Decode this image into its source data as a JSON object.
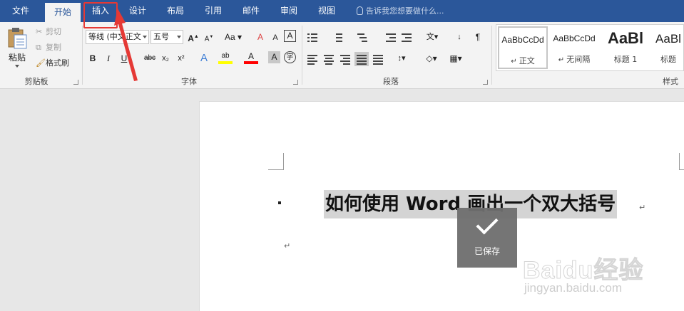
{
  "tabs": [
    {
      "label": "文件"
    },
    {
      "label": "开始"
    },
    {
      "label": "插入"
    },
    {
      "label": "设计"
    },
    {
      "label": "布局"
    },
    {
      "label": "引用"
    },
    {
      "label": "邮件"
    },
    {
      "label": "审阅"
    },
    {
      "label": "视图"
    }
  ],
  "tell_me": {
    "placeholder": "告诉我您想要做什么..."
  },
  "clipboard": {
    "paste_label": "粘贴",
    "cut_label": "剪切",
    "copy_label": "复制",
    "format_painter_label": "格式刷",
    "group_label": "剪贴板"
  },
  "font": {
    "font_name": "等线 (中文正文",
    "font_size": "五号",
    "group_label": "字体",
    "case_label": "Aa",
    "bold": "B",
    "italic": "I",
    "underline": "U",
    "strike": "abc",
    "subscript": "x₂",
    "superscript": "x²",
    "grow": "A",
    "shrink": "A",
    "clear_format": "A",
    "phonetic": "A",
    "border_char": "A",
    "text_effect": "A",
    "highlight": "ab",
    "font_color": "A",
    "char_shading": "A",
    "enclose": "字"
  },
  "paragraph": {
    "group_label": "段落"
  },
  "styles": {
    "group_label": "样式",
    "items": [
      {
        "sample": "AaBbCcDd",
        "name": "正文"
      },
      {
        "sample": "AaBbCcDd",
        "name": "无间隔"
      },
      {
        "sample": "AaBl",
        "name": "标题 1"
      },
      {
        "sample": "AaBl",
        "name": "标题"
      }
    ]
  },
  "document": {
    "heading": "如何使用 Word 画出一个双大括号"
  },
  "toast": {
    "label": "已保存"
  },
  "watermark": {
    "brand": "Baidu经验",
    "url": "jingyan.baidu.com"
  },
  "colors": {
    "accent": "#2b579a",
    "annotation": "#e53935",
    "highlight_yellow": "#ffff00",
    "font_red": "#ff0000"
  }
}
